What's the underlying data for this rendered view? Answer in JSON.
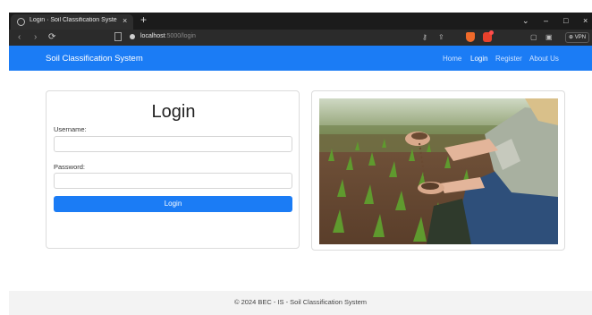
{
  "browser": {
    "tab_title": "Login · Soil Classification Syste",
    "tab_close": "×",
    "new_tab": "+",
    "url_host": "localhost",
    "url_path": ":5000/login",
    "vpn_label": "⊕ VPN",
    "window_controls": [
      "⌄",
      "–",
      "□",
      "×"
    ]
  },
  "navbar": {
    "brand": "Soil Classification System",
    "links": [
      "Home",
      "Login",
      "Register",
      "About Us"
    ],
    "color": "#1b7cf5"
  },
  "login": {
    "title": "Login",
    "username_label": "Username:",
    "username_value": "",
    "password_label": "Password:",
    "password_value": "",
    "button_label": "Login"
  },
  "image": {
    "icon": "farmer-holding-soil-photo"
  },
  "footer": {
    "text": "© 2024 BEC - IS - Soil Classification System"
  }
}
